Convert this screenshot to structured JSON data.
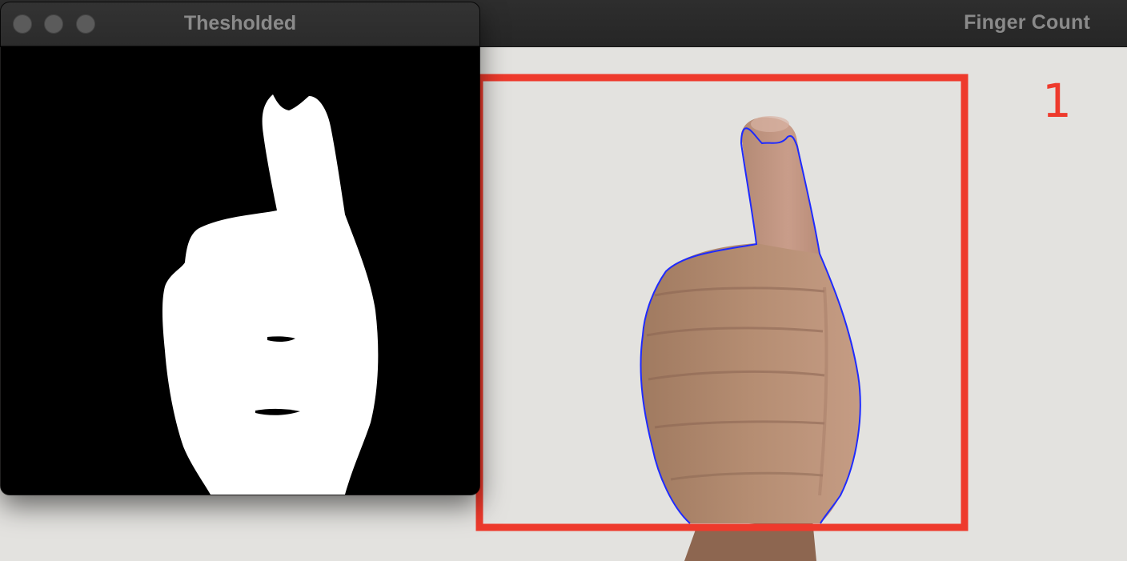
{
  "windows": {
    "finger_count": {
      "title": "Finger Count",
      "count_value": "1"
    },
    "thresholded": {
      "title": "Thesholded"
    }
  },
  "colors": {
    "roi_box": "#ee3a2c",
    "contour": "#1f2bff",
    "count_text": "#ee3a2c",
    "wall": "#e3e2df",
    "mask_foreground": "#ffffff",
    "mask_background": "#000000",
    "titlebar_text": "#8a8a8a",
    "traffic_light": "#5b5b5b"
  },
  "icons": {
    "close": "traffic-light-close-icon",
    "minimize": "traffic-light-minimize-icon",
    "zoom": "traffic-light-zoom-icon"
  }
}
